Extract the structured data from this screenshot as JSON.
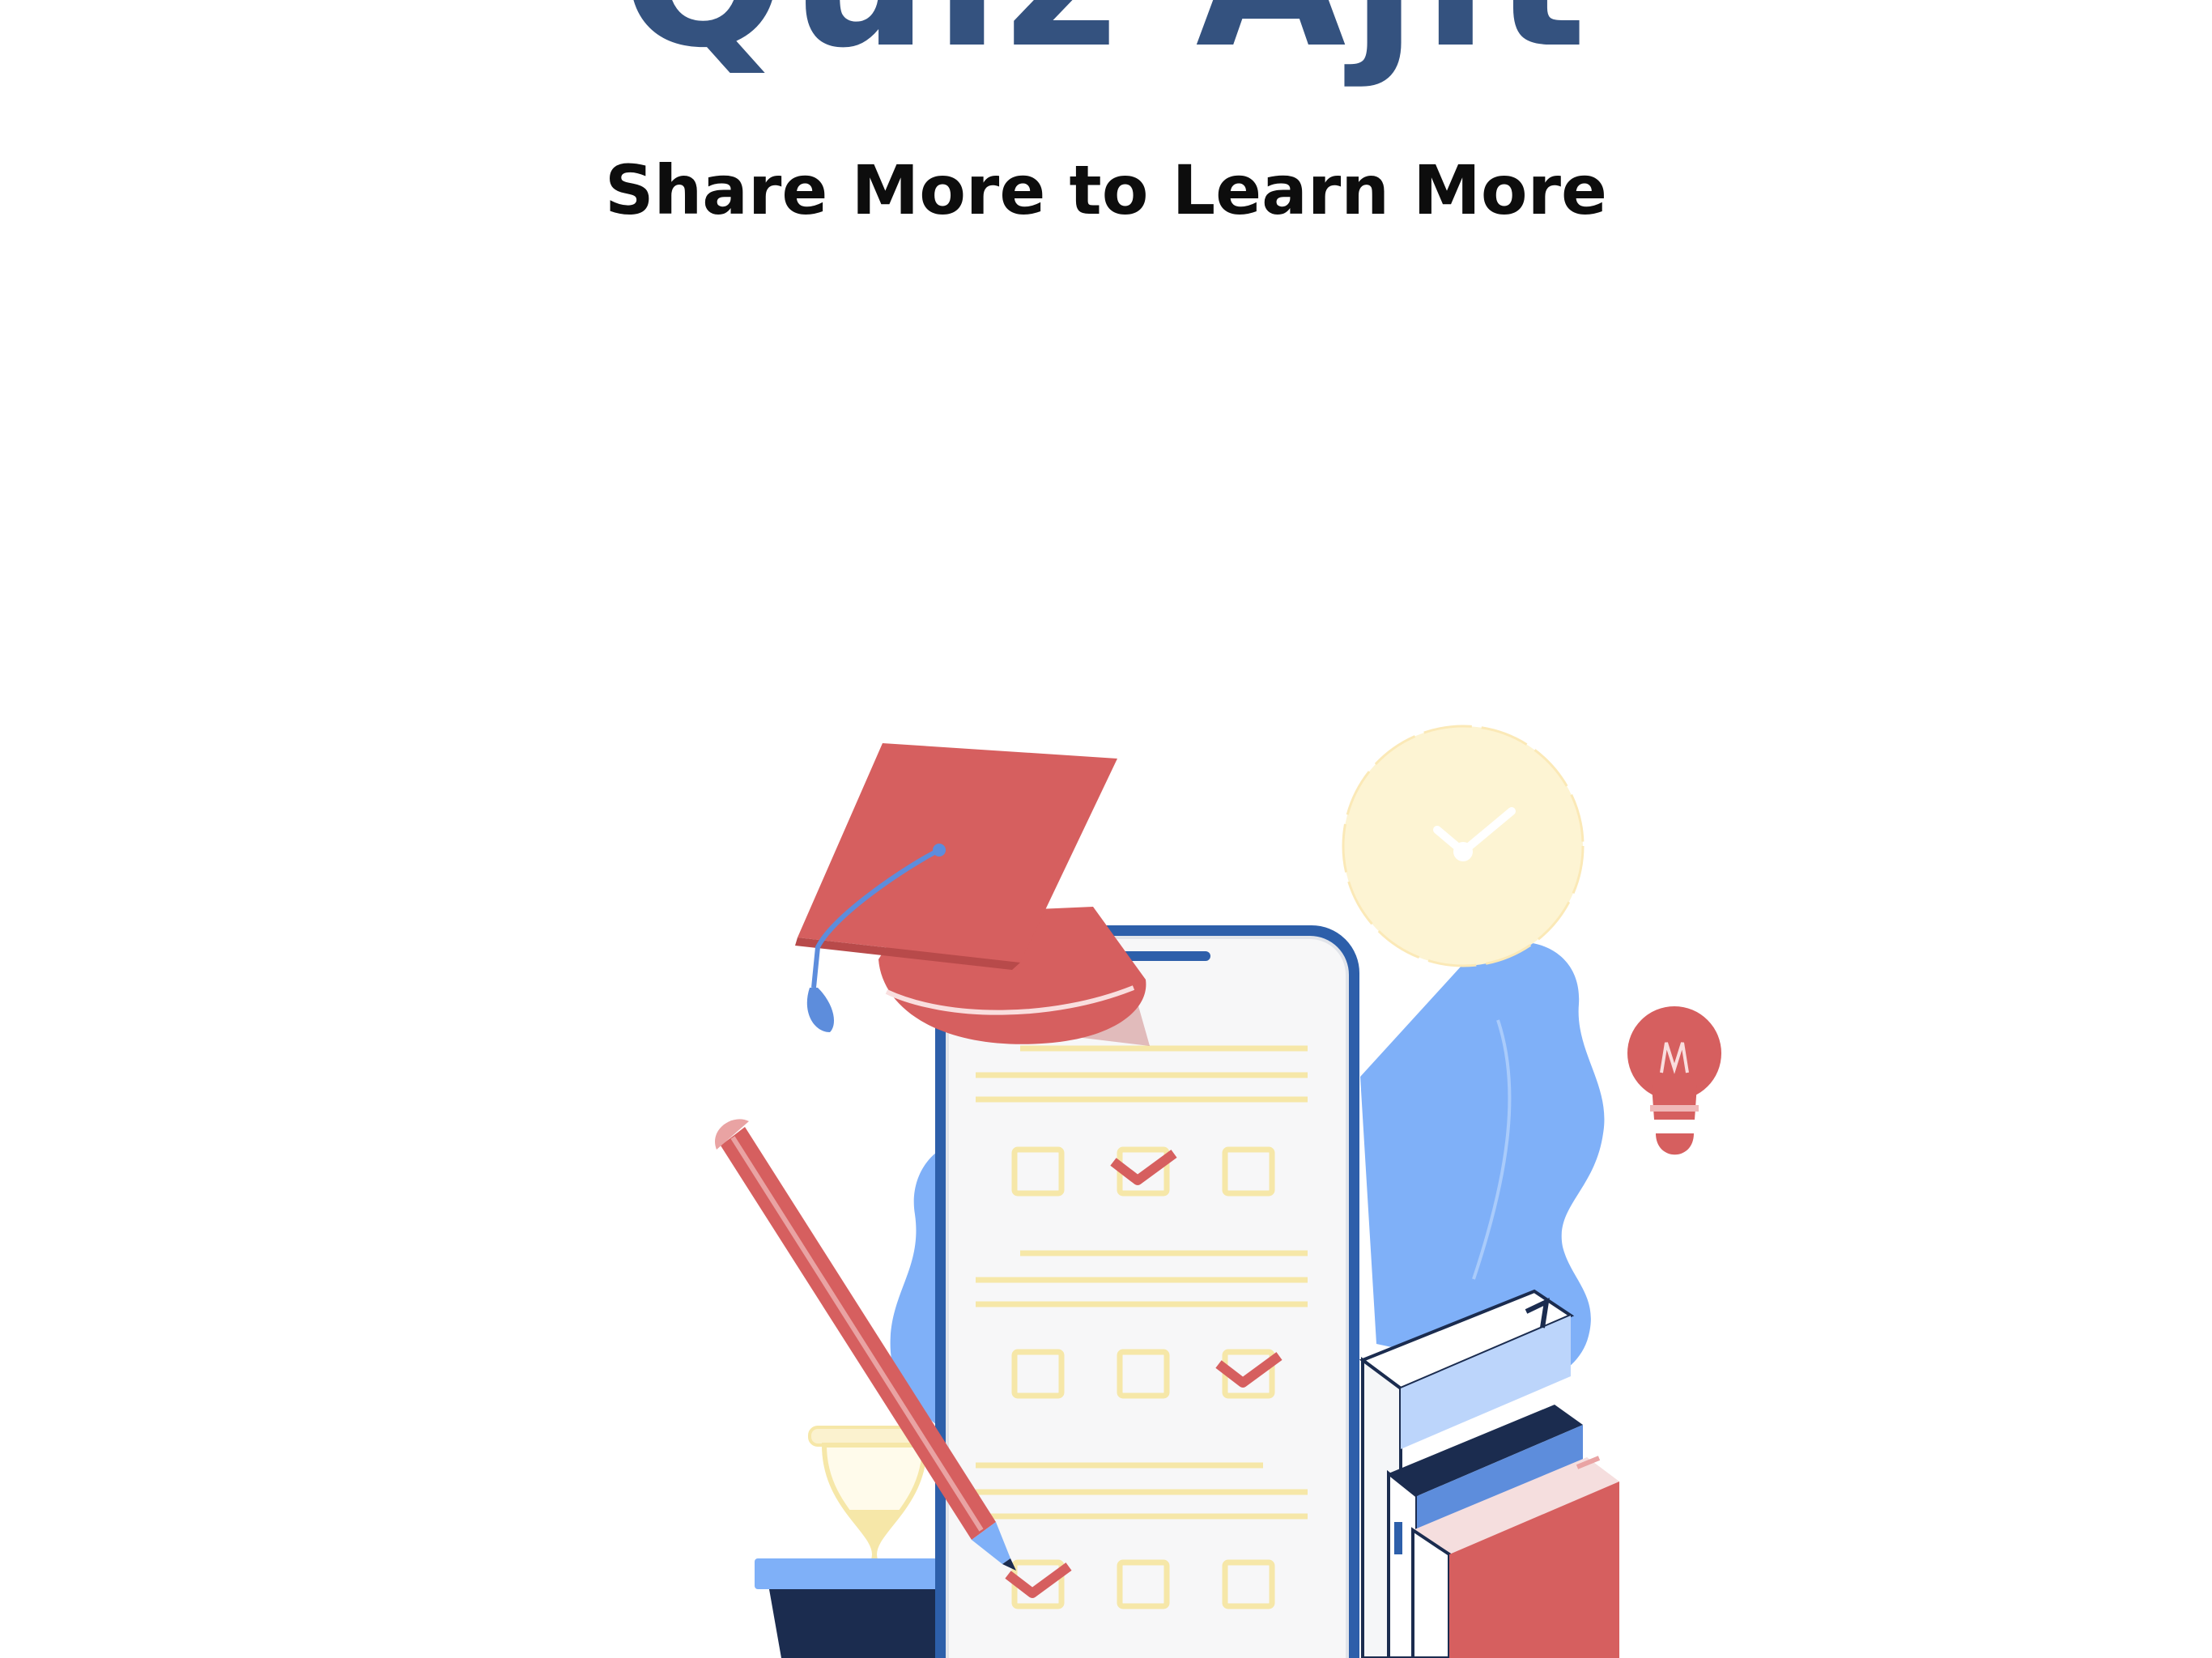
{
  "app": {
    "title": "Quiz Ajit",
    "tagline": "Share More to Learn More"
  },
  "illustration": {
    "subject": "quiz-study-illustration",
    "icons": [
      "graduation-cap-icon",
      "smartphone-icon",
      "clock-icon",
      "lightbulb-icon",
      "pencil-icon",
      "hourglass-icon",
      "books-icon",
      "plant-icon",
      "checkbox-icon",
      "checkmark-icon"
    ]
  },
  "colors": {
    "brand": "#34527f",
    "accent_red": "#d65f5f",
    "accent_blue": "#7fb0f8",
    "accent_yellow": "#f6e7a8",
    "navy": "#1b2c4f"
  }
}
